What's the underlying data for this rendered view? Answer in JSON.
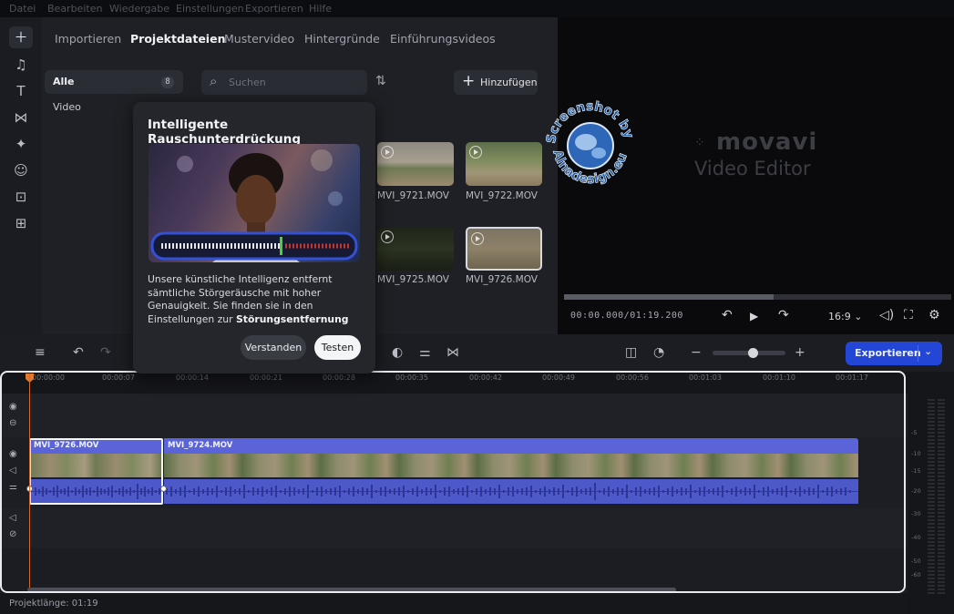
{
  "menu": [
    "Datei",
    "Bearbeiten",
    "Wiedergabe",
    "Einstellungen",
    "Exportieren",
    "Hilfe"
  ],
  "rail": [
    "plus-icon",
    "music-icon",
    "text-icon",
    "transition-icon",
    "magic-wand-icon",
    "sticker-icon",
    "bag-icon",
    "more-tools-icon"
  ],
  "tabs": [
    "Importieren",
    "Projektdateien",
    "Mustervideo",
    "Hintergründe",
    "Einführungsvideos"
  ],
  "active_tab": "Projektdateien",
  "categories": {
    "all": "Alle",
    "all_count": "8",
    "video": "Video"
  },
  "search": {
    "placeholder": "Suchen"
  },
  "add_label": "Hinzufügen",
  "thumbs": [
    "MVI_9721.MOV",
    "MVI_9722.MOV",
    "MVI_9725.MOV",
    "MVI_9726.MOV"
  ],
  "brand": {
    "name": "movavi",
    "sub": "Video Editor"
  },
  "player": {
    "timecode": "00:00.000/01:19.200",
    "ratio": "16:9",
    "progress": 0.54
  },
  "popup": {
    "title": "Intelligente Rauschunterdrückung",
    "body": "Unsere künstliche Intelligenz entfernt sämtliche Störgeräusche mit hoher Genauigkeit. Sie finden sie in den Einstellungen zur",
    "body_bold": "Störungsentfernung",
    "ok": "Verstanden",
    "test": "Testen"
  },
  "export_label": "Exportieren",
  "zoom_level": 0.55,
  "ruler": [
    "00:00:00",
    "00:00:07",
    "00:00:14",
    "00:00:21",
    "00:00:28",
    "00:00:35",
    "00:00:42",
    "00:00:49",
    "00:00:56",
    "00:01:03",
    "00:01:10",
    "00:01:17"
  ],
  "clips": [
    "MVI_9726.MOV",
    "MVI_9724.MOV"
  ],
  "meter_labels": [
    "-5",
    "-10",
    "-15",
    "-20",
    "-30",
    "-40",
    "-50",
    "-60"
  ],
  "status": "Projektlänge: 01:19",
  "watermark": [
    "Screenshot by",
    "Alnadesign.eu"
  ],
  "colors": {
    "accent": "#2446d6",
    "clip": "#5a64d8",
    "playhead": "#d76b2a"
  }
}
